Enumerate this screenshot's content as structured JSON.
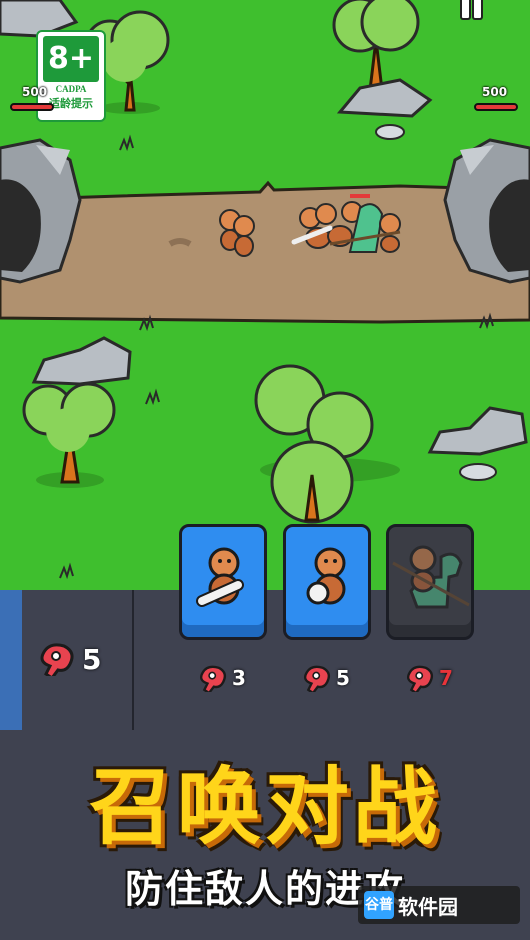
{
  "rating": {
    "age": "8+",
    "org": "CADPA",
    "tip": "适龄提示"
  },
  "player_base": {
    "hp": "500"
  },
  "enemy_base": {
    "hp": "500"
  },
  "resources": {
    "meat_count": "5"
  },
  "cards": [
    {
      "unit": "caveman-club",
      "cost": "3",
      "affordable": true
    },
    {
      "unit": "caveman-rock",
      "cost": "5",
      "affordable": true
    },
    {
      "unit": "dino-rider-spear",
      "cost": "7",
      "affordable": false
    }
  ],
  "banner": {
    "title": "召唤对战",
    "subtitle": "防住敌人的进攻"
  },
  "watermark": {
    "logo": "谷普",
    "text": "软件园",
    "sub": "谷普"
  },
  "colors": {
    "grass": "#3fbf2e",
    "dirt": "#b0916f",
    "panel": "#3f4250",
    "card_blue": "#2f8df0",
    "title_yellow": "#ffd51a",
    "hp_red": "#e43a3a"
  }
}
